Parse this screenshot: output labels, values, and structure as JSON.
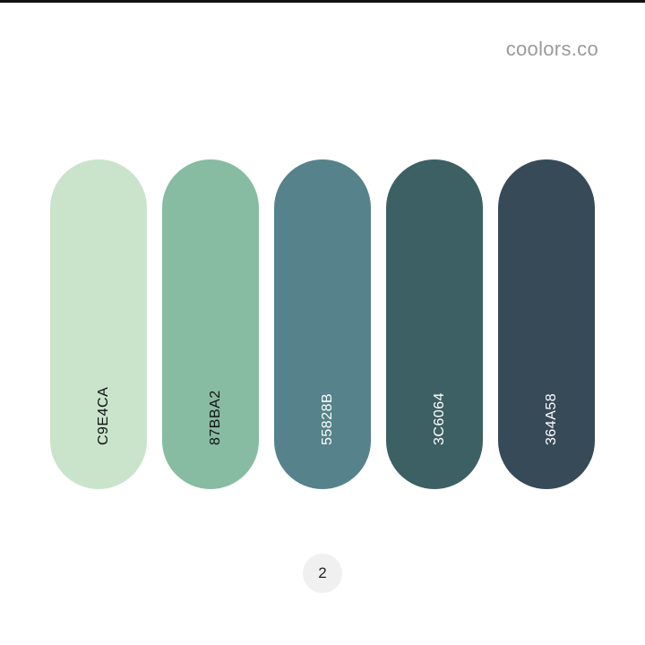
{
  "brand": {
    "name": "coolors.co"
  },
  "palette": {
    "swatches": [
      {
        "hex": "C9E4CA",
        "color": "#C9E4CA",
        "text_color": "#111111"
      },
      {
        "hex": "87BBA2",
        "color": "#87BBA2",
        "text_color": "#111111"
      },
      {
        "hex": "55828B",
        "color": "#55828B",
        "text_color": "#ffffff"
      },
      {
        "hex": "3C6064",
        "color": "#3C6064",
        "text_color": "#ffffff"
      },
      {
        "hex": "364A58",
        "color": "#364A58",
        "text_color": "#ffffff"
      }
    ]
  },
  "pagination": {
    "page": "2"
  }
}
